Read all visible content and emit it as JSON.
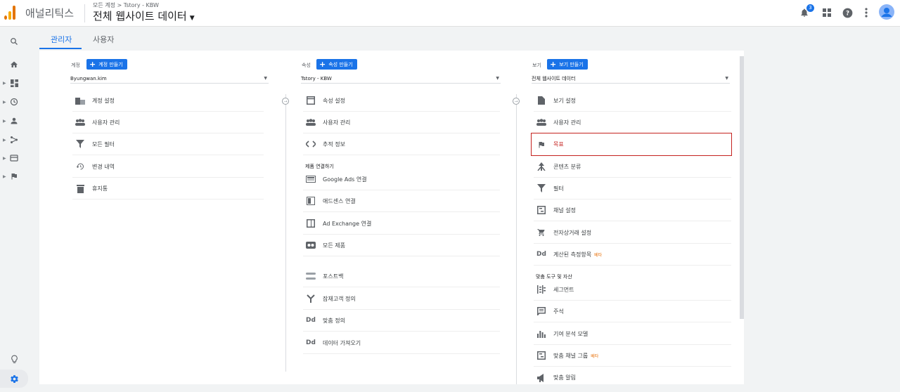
{
  "app": {
    "name": "애널리틱스",
    "breadcrumb": "모든 계정 > Tstory - KBW",
    "view_title": "전체 웹사이트 데이터"
  },
  "topbar": {
    "notification_count": "3",
    "icons": [
      "bell-icon",
      "apps-grid-icon",
      "help-icon",
      "more-vert-icon",
      "avatar"
    ]
  },
  "colors": {
    "accent": "#1a73e8",
    "selected": "#c5221f",
    "beta": "#e8710a"
  },
  "tabs": [
    {
      "label": "관리자"
    },
    {
      "label": "사용자"
    }
  ],
  "account": {
    "heading": "계정",
    "create_label": "계정 만들기",
    "selected": "Byungwan.kim",
    "items": [
      {
        "label": "계정 설정",
        "icon": "building-icon"
      },
      {
        "label": "사용자 관리",
        "icon": "people-icon"
      },
      {
        "label": "모든 필터",
        "icon": "filter-icon"
      },
      {
        "label": "변경 내역",
        "icon": "history-icon"
      },
      {
        "label": "휴지통",
        "icon": "trash-icon"
      }
    ]
  },
  "property": {
    "heading": "속성",
    "create_label": "속성 만들기",
    "selected": "Tstory - KBW",
    "items": [
      {
        "label": "속성 설정",
        "icon": "window-icon"
      },
      {
        "label": "사용자 관리",
        "icon": "people-icon"
      },
      {
        "label": "추적 정보",
        "icon": "code-icon"
      }
    ],
    "section_label": "제품 연결하기",
    "product_items": [
      {
        "label": "Google Ads 연결",
        "icon": "ads-icon"
      },
      {
        "label": "애드센스 연결",
        "icon": "adsense-icon"
      },
      {
        "label": "Ad Exchange 연결",
        "icon": "adexchange-icon"
      },
      {
        "label": "모든 제품",
        "icon": "link-icon"
      }
    ],
    "other_items": [
      {
        "label": "포스트백",
        "icon": "postback-icon"
      },
      {
        "label": "잠재고객 정의",
        "icon": "audience-icon"
      },
      {
        "label": "맞춤 정의",
        "icon": "dd-icon"
      },
      {
        "label": "데이터 가져오기",
        "icon": "dd-icon"
      }
    ]
  },
  "view": {
    "heading": "보기",
    "create_label": "보기 만들기",
    "selected": "전체 웹사이트 데이터",
    "items": [
      {
        "label": "보기 설정",
        "icon": "document-icon"
      },
      {
        "label": "사용자 관리",
        "icon": "people-icon"
      },
      {
        "label": "목표",
        "icon": "flag-icon"
      },
      {
        "label": "콘텐츠 분류",
        "icon": "grouping-icon"
      },
      {
        "label": "필터",
        "icon": "filter-icon"
      },
      {
        "label": "채널 설정",
        "icon": "channel-icon"
      },
      {
        "label": "전자상거래 설정",
        "icon": "cart-icon"
      },
      {
        "label": "계산된 측정항목",
        "icon": "dd-icon",
        "beta": "베타"
      }
    ],
    "section_label": "맞춤 도구 및 자산",
    "tool_items": [
      {
        "label": "세그먼트",
        "icon": "segment-icon"
      },
      {
        "label": "주석",
        "icon": "comment-icon"
      },
      {
        "label": "기여 분석 모델",
        "icon": "bar-chart-icon"
      },
      {
        "label": "맞춤 채널 그룹",
        "icon": "channel-icon",
        "beta": "베타"
      },
      {
        "label": "맞춤 알림",
        "icon": "megaphone-icon"
      }
    ]
  }
}
